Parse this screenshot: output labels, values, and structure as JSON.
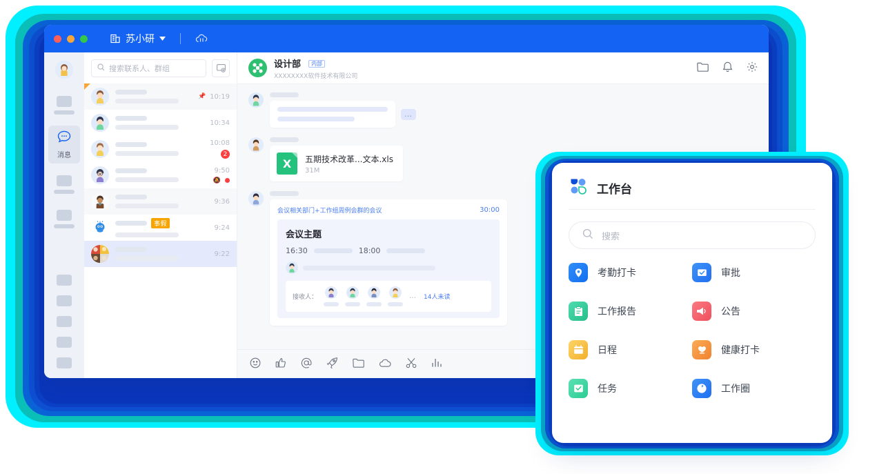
{
  "window": {
    "titlebar": {
      "org_name": "苏小研",
      "org_icon": "building-icon",
      "dropdown_icon": "chevron-down-icon",
      "cloud_icon": "cloud-icon",
      "traffic_lights": [
        "close-red",
        "minimize-amber",
        "maximize-green"
      ]
    }
  },
  "rail": {
    "active_item": {
      "label": "消息",
      "icon": "message-icon"
    }
  },
  "chatlist": {
    "search": {
      "placeholder": "搜索联系人、群组",
      "icon": "search-icon"
    },
    "new_chat_icon": "new-chat-icon",
    "rows": [
      {
        "time": "10:19",
        "pinned": true,
        "pin_icon": "pin-icon",
        "badge": "",
        "muted": false,
        "tag": ""
      },
      {
        "time": "10:34",
        "pinned": false,
        "badge": "",
        "muted": false,
        "tag": ""
      },
      {
        "time": "10:08",
        "pinned": false,
        "badge": "2",
        "muted": false,
        "tag": ""
      },
      {
        "time": "9:50",
        "pinned": false,
        "badge": "",
        "muted": true,
        "tag": ""
      },
      {
        "time": "9:36",
        "pinned": false,
        "badge": "",
        "muted": false,
        "tag": ""
      },
      {
        "time": "9:24",
        "pinned": false,
        "badge": "",
        "muted": false,
        "tag": "事假"
      },
      {
        "time": "9:22",
        "pinned": false,
        "badge": "",
        "muted": false,
        "tag": "",
        "selected": true
      }
    ]
  },
  "conversation": {
    "header": {
      "group_name": "设计部",
      "group_tag": "内部",
      "company": "XXXXXXXX软件技术有限公司",
      "icons": [
        "folder-icon",
        "bell-icon",
        "gear-icon"
      ]
    },
    "messages": {
      "more_icon": "…",
      "file": {
        "name": "五期技术改革...文本.xls",
        "size": "31M",
        "type_letter": "X"
      },
      "meeting": {
        "title": "会议相关部门+工作组周例会群的会议",
        "duration": "30:00",
        "subject": "会议主题",
        "start_time": "16:30",
        "end_time": "18:00",
        "recipients_label": "接收人：",
        "recipients_overflow": "…",
        "unread_text": "14人未读"
      }
    },
    "composer_icons": [
      "emoji-icon",
      "thumbs-up-icon",
      "mention-icon",
      "rocket-icon",
      "folder-icon",
      "cloud-icon",
      "scissors-icon",
      "chart-icon"
    ]
  },
  "workbench": {
    "title": "工作台",
    "logo_icon": "workbench-logo-icon",
    "search": {
      "placeholder": "搜索",
      "icon": "search-icon"
    },
    "apps": [
      {
        "label": "考勤打卡",
        "icon": "location-pin-icon",
        "color": "#1d7af5"
      },
      {
        "label": "审批",
        "icon": "approval-check-icon",
        "color": "#2b7ef0"
      },
      {
        "label": "工作报告",
        "icon": "report-doc-icon",
        "color": "#38cc95"
      },
      {
        "label": "公告",
        "icon": "megaphone-icon",
        "color": "#f4616b"
      },
      {
        "label": "日程",
        "icon": "calendar-icon",
        "color": "#f6c13f"
      },
      {
        "label": "健康打卡",
        "icon": "health-heart-icon",
        "color": "#f59240"
      },
      {
        "label": "任务",
        "icon": "task-check-icon",
        "color": "#3ed39b"
      },
      {
        "label": "工作圈",
        "icon": "circle-share-icon",
        "color": "#2b7ef0"
      }
    ]
  },
  "colors": {
    "brand_blue": "#1463f3",
    "glow_cyan": "#00f0ff",
    "accent_red": "#fa3f3f",
    "accent_orange": "#f7a400"
  }
}
